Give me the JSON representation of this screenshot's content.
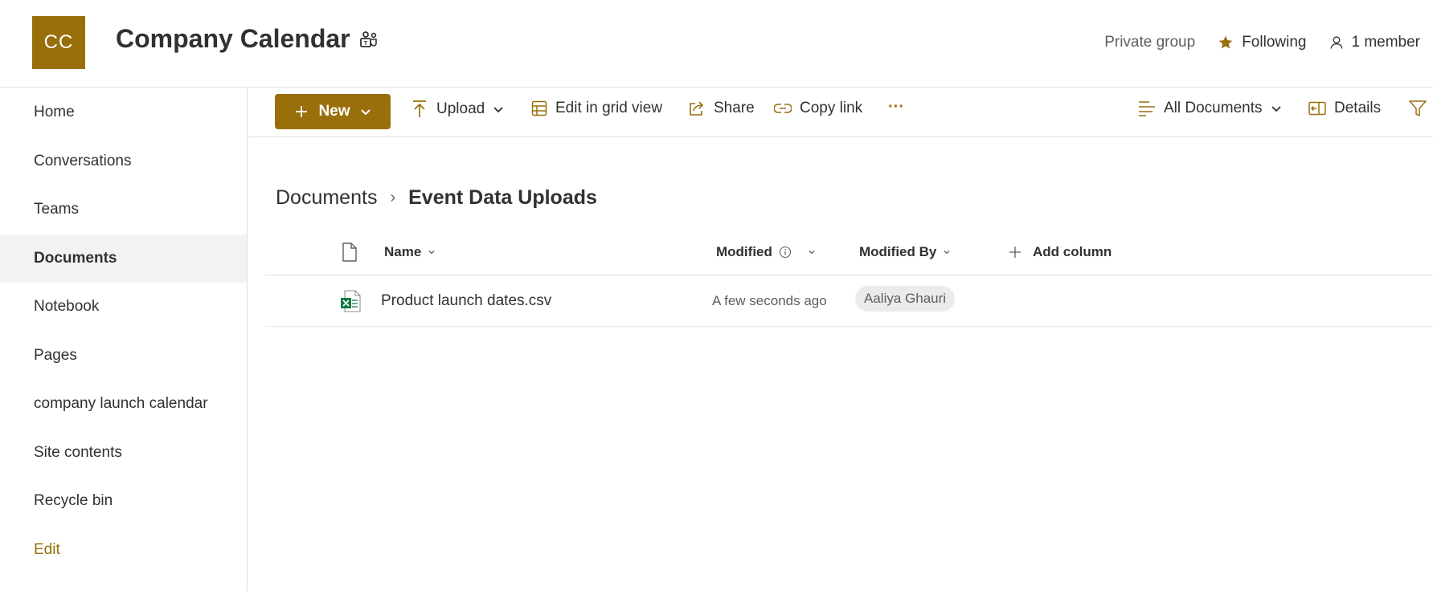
{
  "header": {
    "logo_initials": "CC",
    "site_title": "Company Calendar",
    "private_group": "Private group",
    "following": "Following",
    "members": "1 member"
  },
  "nav": {
    "items": [
      {
        "label": "Home"
      },
      {
        "label": "Conversations"
      },
      {
        "label": "Teams"
      },
      {
        "label": "Documents"
      },
      {
        "label": "Notebook"
      },
      {
        "label": "Pages"
      },
      {
        "label": "company launch calendar"
      },
      {
        "label": "Site contents"
      },
      {
        "label": "Recycle bin"
      },
      {
        "label": "Edit"
      }
    ],
    "active": "Documents"
  },
  "toolbar": {
    "new_label": "New",
    "upload_label": "Upload",
    "grid_label": "Edit in grid view",
    "share_label": "Share",
    "copy_link_label": "Copy link",
    "more_label": "···",
    "view_label": "All Documents",
    "details_label": "Details"
  },
  "breadcrumb": {
    "root": "Documents",
    "separator": "›",
    "current": "Event Data Uploads"
  },
  "table": {
    "columns": {
      "name": "Name",
      "modified": "Modified",
      "modified_by": "Modified By",
      "add_column": "Add column"
    },
    "rows": [
      {
        "name": "Product launch dates.csv",
        "modified": "A few seconds ago",
        "modified_by": "Aaliya Ghauri"
      }
    ]
  },
  "colors": {
    "accent": "#986f0b",
    "excel_green": "#107c41"
  }
}
